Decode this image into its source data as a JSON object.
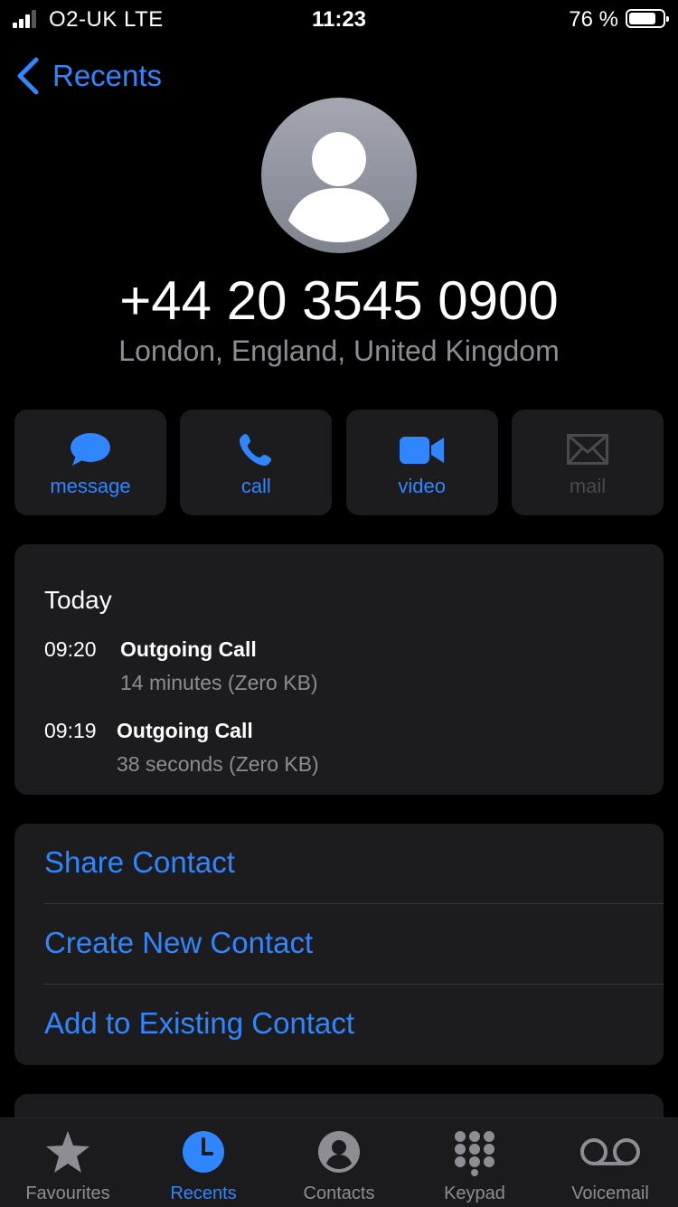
{
  "status_bar": {
    "carrier": "O2-UK  LTE",
    "time": "11:23",
    "battery": "76 %"
  },
  "nav": {
    "back_label": "Recents"
  },
  "contact": {
    "number": "+44 20 3545 0900",
    "location": "London, England, United Kingdom"
  },
  "actions": [
    {
      "label": "message",
      "icon": "message-bubble-icon",
      "enabled": true
    },
    {
      "label": "call",
      "icon": "phone-icon",
      "enabled": true
    },
    {
      "label": "video",
      "icon": "video-camera-icon",
      "enabled": true
    },
    {
      "label": "mail",
      "icon": "envelope-icon",
      "enabled": false
    }
  ],
  "recents": {
    "day": "Today",
    "calls": [
      {
        "time": "09:20",
        "type": "Outgoing Call",
        "detail": "14 minutes (Zero KB)"
      },
      {
        "time": "09:19",
        "type": "Outgoing Call",
        "detail": "38 seconds (Zero KB)"
      }
    ]
  },
  "contact_actions": [
    "Share Contact",
    "Create New Contact",
    "Add to Existing Contact"
  ],
  "tabs": [
    {
      "label": "Favourites",
      "icon": "star-icon",
      "active": false
    },
    {
      "label": "Recents",
      "icon": "clock-icon",
      "active": true
    },
    {
      "label": "Contacts",
      "icon": "person-circle-icon",
      "active": false
    },
    {
      "label": "Keypad",
      "icon": "keypad-icon",
      "active": false
    },
    {
      "label": "Voicemail",
      "icon": "voicemail-icon",
      "active": false
    }
  ],
  "colors": {
    "accent": "#2f86ff",
    "card": "#1c1c1e",
    "secondary_text": "#8d8d93"
  }
}
